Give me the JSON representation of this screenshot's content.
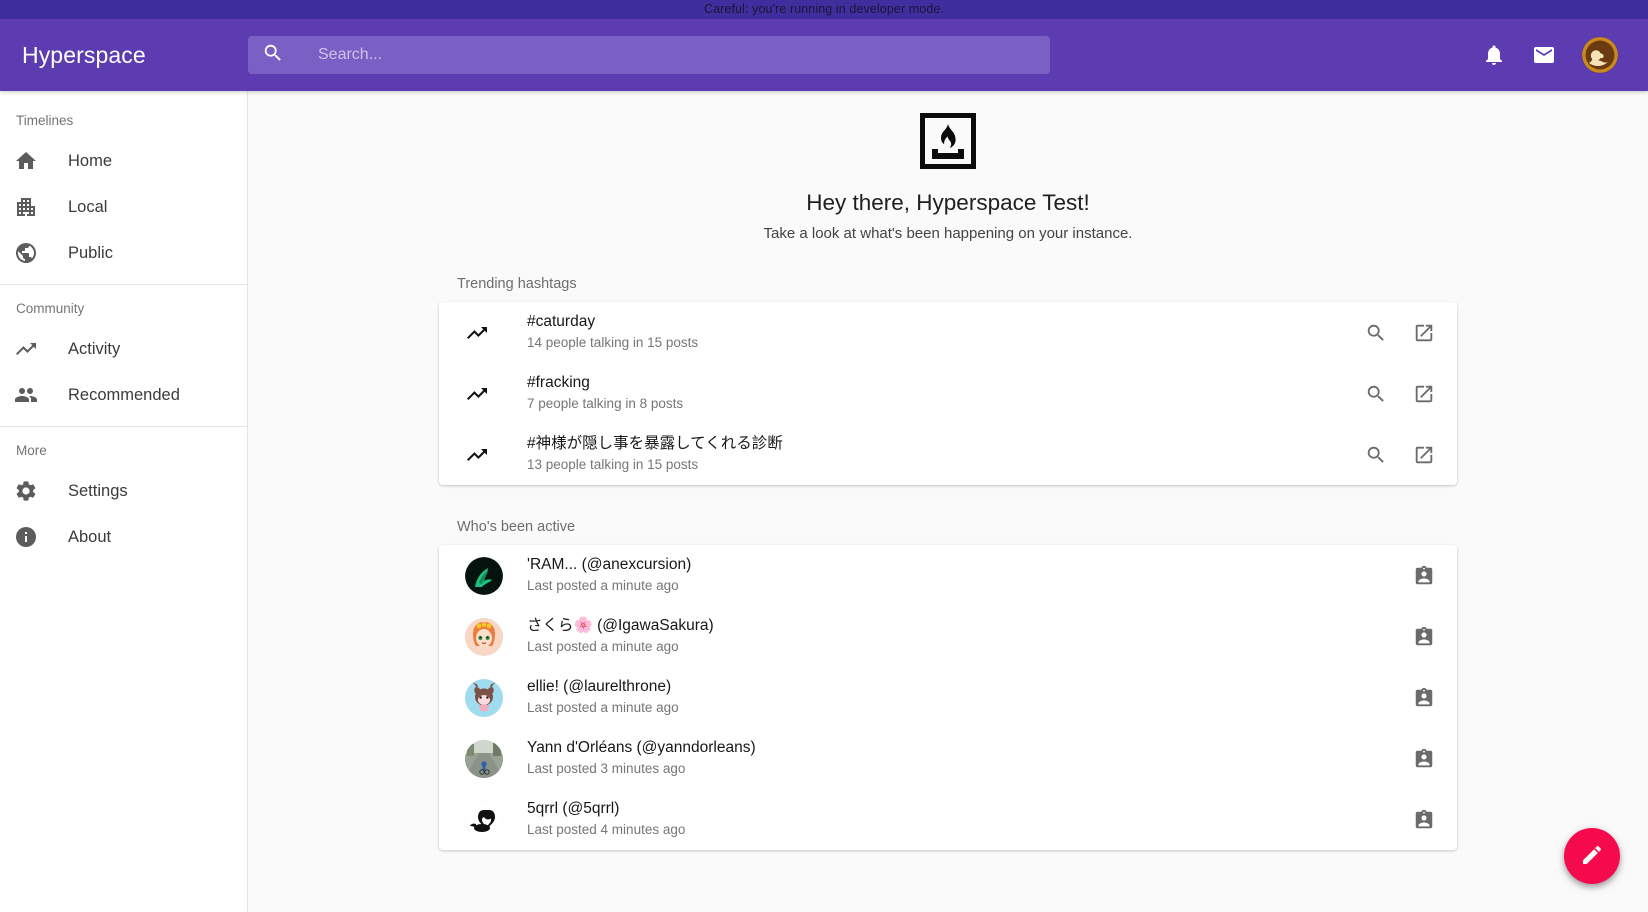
{
  "dev_banner": {
    "text": "Careful: you're running in developer mode."
  },
  "appbar": {
    "brand": "Hyperspace",
    "search": {
      "placeholder": "Search...",
      "value": ""
    },
    "notifications_label": "Notifications",
    "messages_label": "Messages",
    "account_label": "Account"
  },
  "sidebar": {
    "groups": [
      {
        "label": "Timelines",
        "items": [
          {
            "label": "Home",
            "icon": "home-icon"
          },
          {
            "label": "Local",
            "icon": "apartment-icon"
          },
          {
            "label": "Public",
            "icon": "public-globe-icon"
          }
        ]
      },
      {
        "label": "Community",
        "items": [
          {
            "label": "Activity",
            "icon": "trending-up-icon"
          },
          {
            "label": "Recommended",
            "icon": "people-icon"
          }
        ]
      },
      {
        "label": "More",
        "items": [
          {
            "label": "Settings",
            "icon": "gear-icon"
          },
          {
            "label": "About",
            "icon": "info-icon"
          }
        ]
      }
    ]
  },
  "hero": {
    "logo_icon": "fireplace-logo-icon",
    "title": "Hey there, Hyperspace Test!",
    "subtitle": "Take a look at what's been happening on your instance."
  },
  "trending": {
    "section_title": "Trending hashtags",
    "items": [
      {
        "tag": "#caturday",
        "stats": "14 people talking in 15 posts"
      },
      {
        "tag": "#fracking",
        "stats": "7 people talking in 8 posts"
      },
      {
        "tag": "#神様が隠し事を暴露してくれる診断",
        "stats": "13 people talking in 15 posts"
      }
    ],
    "search_action_label": "Search hashtag",
    "open_action_label": "Open hashtag"
  },
  "active_users": {
    "section_title": "Who's been active",
    "items": [
      {
        "name": "'RAM... (@anexcursion)",
        "subtitle": "Last posted a minute ago",
        "avatar": "dark-green-character-avatar"
      },
      {
        "name": "さくら🌸 (@IgawaSakura)",
        "subtitle": "Last posted a minute ago",
        "avatar": "anime-girl-avatar"
      },
      {
        "name": "ellie! (@laurelthrone)",
        "subtitle": "Last posted a minute ago",
        "avatar": "pink-deer-avatar"
      },
      {
        "name": "Yann d'Orléans (@yanndorleans)",
        "subtitle": "Last posted 3 minutes ago",
        "avatar": "cyclist-photo-avatar"
      },
      {
        "name": "5qrrl (@5qrrl)",
        "subtitle": "Last posted 4 minutes ago",
        "avatar": "black-squirrel-avatar"
      }
    ],
    "profile_action_label": "View profile"
  },
  "fab": {
    "label": "Compose",
    "icon": "pencil-icon",
    "color": "#f50a4d"
  },
  "theme": {
    "appbar_color": "#5c3cb0",
    "banner_color": "#3f2f9e",
    "fab_color": "#f50a4d",
    "page_bg": "#fafafa"
  }
}
